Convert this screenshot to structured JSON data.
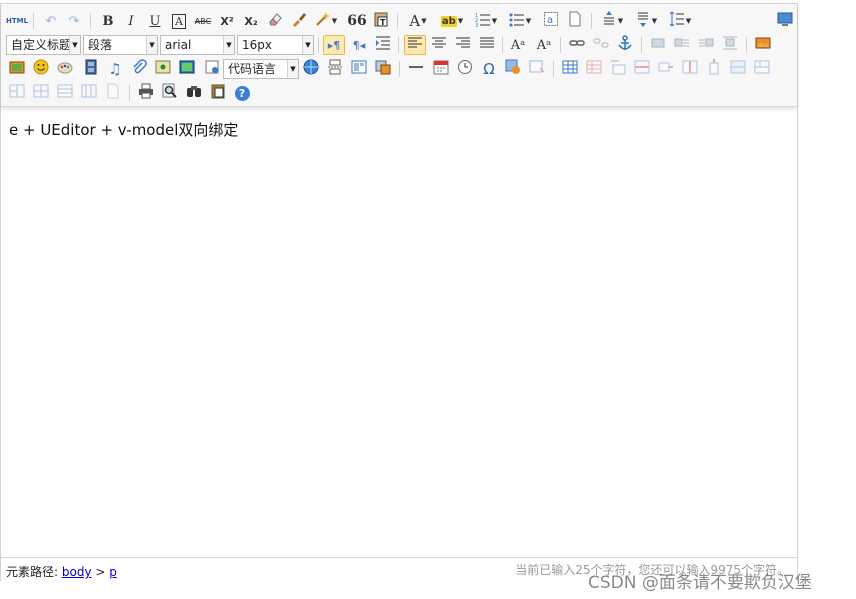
{
  "toolbar": {
    "html_label": "HTML",
    "paragraph_format": "自定义标题",
    "block_type": "段落",
    "font_family": "arial",
    "font_size": "16px",
    "code_language": "代码语言",
    "bold": "B",
    "italic": "I",
    "underline": "U",
    "font_border": "A",
    "strike": "ABC",
    "superscript": "X²",
    "subscript": "X₂",
    "blockquote": "66",
    "forecolor": "A",
    "omega": "Ω",
    "help": "?"
  },
  "colors": {
    "active_bg": "#fce8b2",
    "link": "#0000cc",
    "icon_blue": "#3b78c9",
    "icon_orange": "#e8902a",
    "icon_green": "#44a04a"
  },
  "content": {
    "text": "e + UEditor + v-model双向绑定"
  },
  "statusbar": {
    "path_label": "元素路径:",
    "path_body": "body",
    "path_sep": ">",
    "path_p": "p",
    "wordcount": "当前已输入25个字符，您还可以输入9975个字符。"
  },
  "watermark": "CSDN @面条请不要欺负汉堡"
}
